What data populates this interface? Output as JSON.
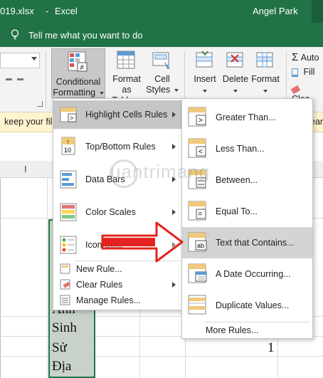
{
  "titlebar": {
    "filename": "019.xlsx",
    "separator": "-",
    "app": "Excel",
    "user": "Angel Park"
  },
  "tell": {
    "text": "Tell me what you want to do"
  },
  "ribbon": {
    "conditional_formatting": [
      "Conditional",
      "Formatting"
    ],
    "format_as_table": [
      "Format as",
      "Table"
    ],
    "cell_styles": [
      "Cell",
      "Styles"
    ],
    "insert": "Insert",
    "delete": "Delete",
    "format": "Format",
    "autosum": "Auto",
    "fill": "Fill",
    "clear": "Clea"
  },
  "notification": {
    "left": "keep your file",
    "right": "earn"
  },
  "sheet": {
    "col_header_visible": "I",
    "cells": [
      "Anh",
      "Sinh",
      "Sử",
      "Địa"
    ],
    "value_cell": "1"
  },
  "menu_main": {
    "items": [
      {
        "label": "Highlight Cells Rules",
        "icon": "highlight-cells-icon"
      },
      {
        "label": "Top/Bottom Rules",
        "icon": "top-bottom-icon"
      },
      {
        "label": "Data Bars",
        "icon": "data-bars-icon"
      },
      {
        "label": "Color Scales",
        "icon": "color-scales-icon"
      },
      {
        "label": "Icon Sets",
        "icon": "icon-sets-icon"
      },
      {
        "label": "New Rule...",
        "icon": "new-rule-icon"
      },
      {
        "label": "Clear Rules",
        "icon": "clear-rules-icon"
      },
      {
        "label": "Manage Rules...",
        "icon": "manage-rules-icon"
      }
    ]
  },
  "menu_sub": {
    "items": [
      {
        "label": "Greater Than...",
        "icon": "greater-than-icon"
      },
      {
        "label": "Less Than...",
        "icon": "less-than-icon"
      },
      {
        "label": "Between...",
        "icon": "between-icon"
      },
      {
        "label": "Equal To...",
        "icon": "equal-to-icon"
      },
      {
        "label": "Text that Contains...",
        "icon": "text-contains-icon"
      },
      {
        "label": "A Date Occurring...",
        "icon": "date-occurring-icon"
      },
      {
        "label": "Duplicate Values...",
        "icon": "duplicate-values-icon"
      },
      {
        "label": "More Rules...",
        "icon": ""
      }
    ]
  },
  "watermark": "uantrimang",
  "colors": {
    "excel_green": "#217346",
    "highlight": "#c6c6c6",
    "arrow_red": "#e3231f",
    "notification": "#fff4ce"
  }
}
